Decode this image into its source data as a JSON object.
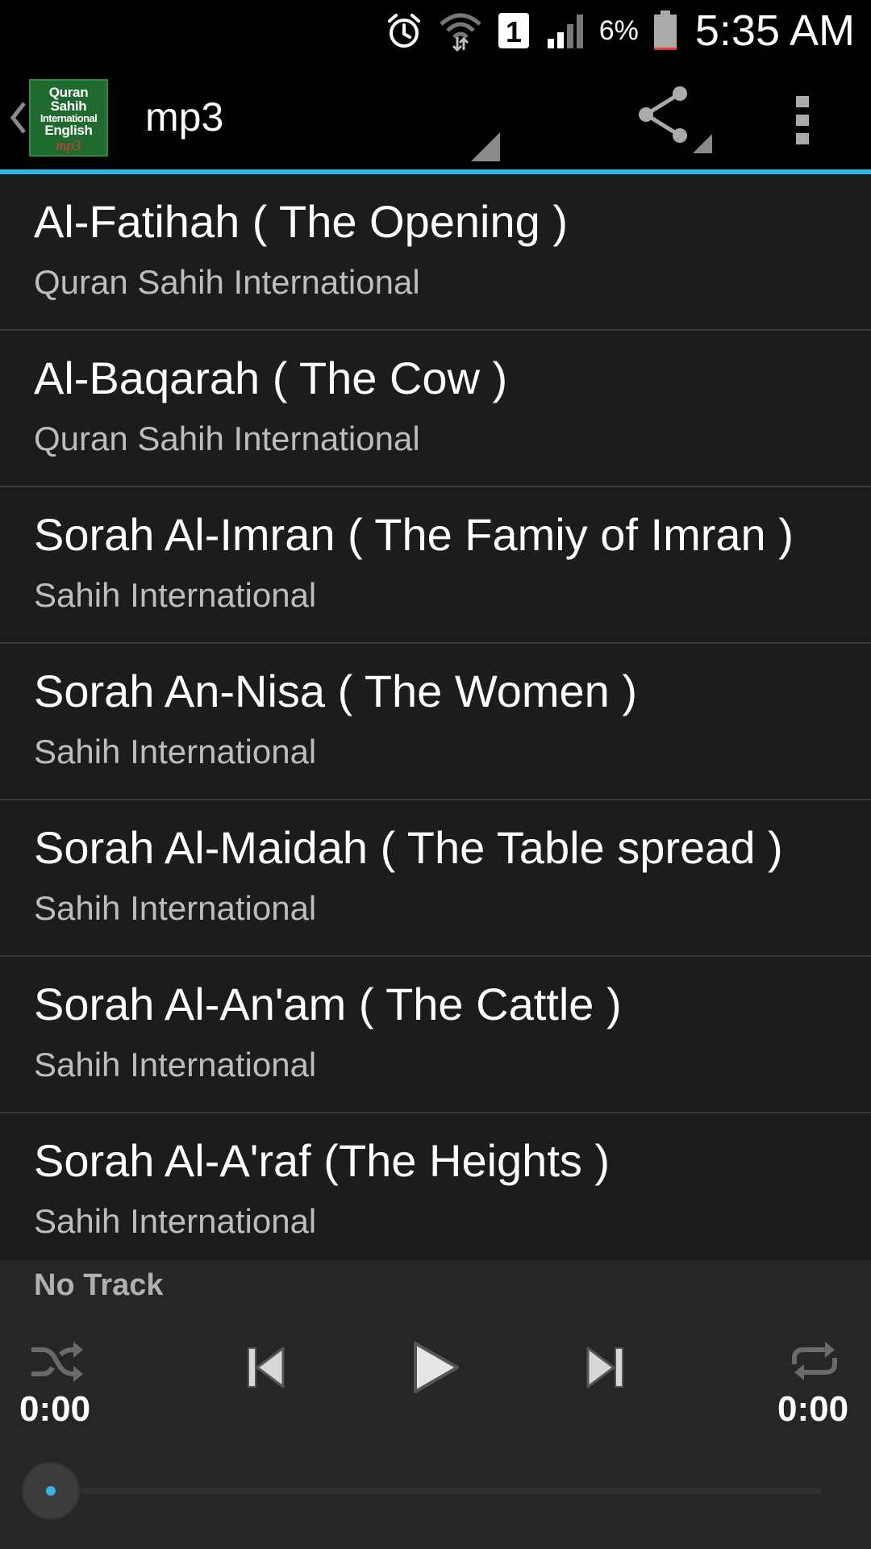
{
  "status_bar": {
    "notification_count": "1",
    "battery_percent": "6%",
    "time": "5:35 AM",
    "icons": [
      "alarm-icon",
      "wifi-icon",
      "notification-badge",
      "signal-icon",
      "battery-icon"
    ]
  },
  "action_bar": {
    "app_logo": {
      "line1": "Quran",
      "line2": "Sahih",
      "line3": "International",
      "line4": "English",
      "line5": "mp3"
    },
    "spinner_label": "mp3",
    "icons": [
      "up-caret-icon",
      "share-icon",
      "overflow-menu-icon"
    ],
    "accent_color": "#33b5e5"
  },
  "tracks": [
    {
      "title": "Al-Fatihah ( The Opening )",
      "subtitle": "Quran Sahih International"
    },
    {
      "title": "Al-Baqarah ( The Cow )",
      "subtitle": "Quran Sahih International"
    },
    {
      "title": "Sorah Al-Imran ( The Famiy of Imran )",
      "subtitle": "Sahih International"
    },
    {
      "title": "Sorah An-Nisa ( The Women )",
      "subtitle": "Sahih International"
    },
    {
      "title": "Sorah Al-Maidah ( The Table spread )",
      "subtitle": "Sahih International"
    },
    {
      "title": "Sorah Al-An'am ( The Cattle )",
      "subtitle": "Sahih International"
    },
    {
      "title": "Sorah Al-A'raf (The Heights )",
      "subtitle": "Sahih International"
    }
  ],
  "player": {
    "now_playing": "No Track",
    "elapsed": "0:00",
    "duration": "0:00",
    "progress": 0.0,
    "icons": [
      "shuffle-icon",
      "previous-icon",
      "play-icon",
      "next-icon",
      "repeat-icon"
    ]
  }
}
